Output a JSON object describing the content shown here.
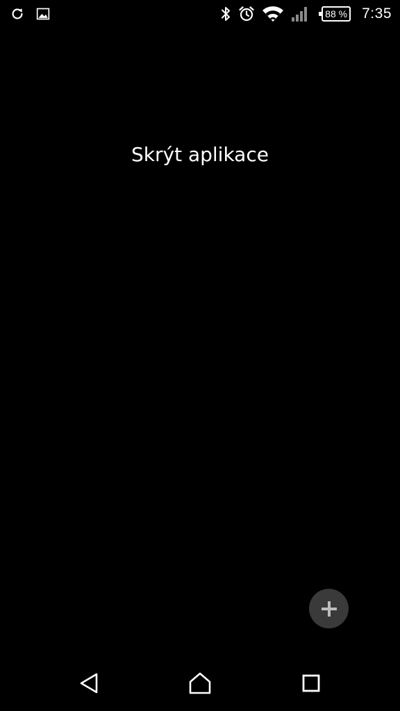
{
  "status_bar": {
    "left_icons": [
      "sync-icon",
      "image-notification-icon"
    ],
    "right_icons": [
      "bluetooth-icon",
      "alarm-icon",
      "wifi-icon",
      "cell-signal-icon"
    ],
    "battery_text": "88 %",
    "battery_level_percent": 88,
    "time": "7:35"
  },
  "main": {
    "title": "Skrýt aplikace"
  },
  "fab": {
    "icon": "plus-icon",
    "color": "#3a3a3a"
  },
  "nav_bar": {
    "icons": [
      "back-icon",
      "home-icon",
      "recents-icon"
    ]
  },
  "colors": {
    "background": "#000000",
    "foreground": "#ffffff"
  }
}
